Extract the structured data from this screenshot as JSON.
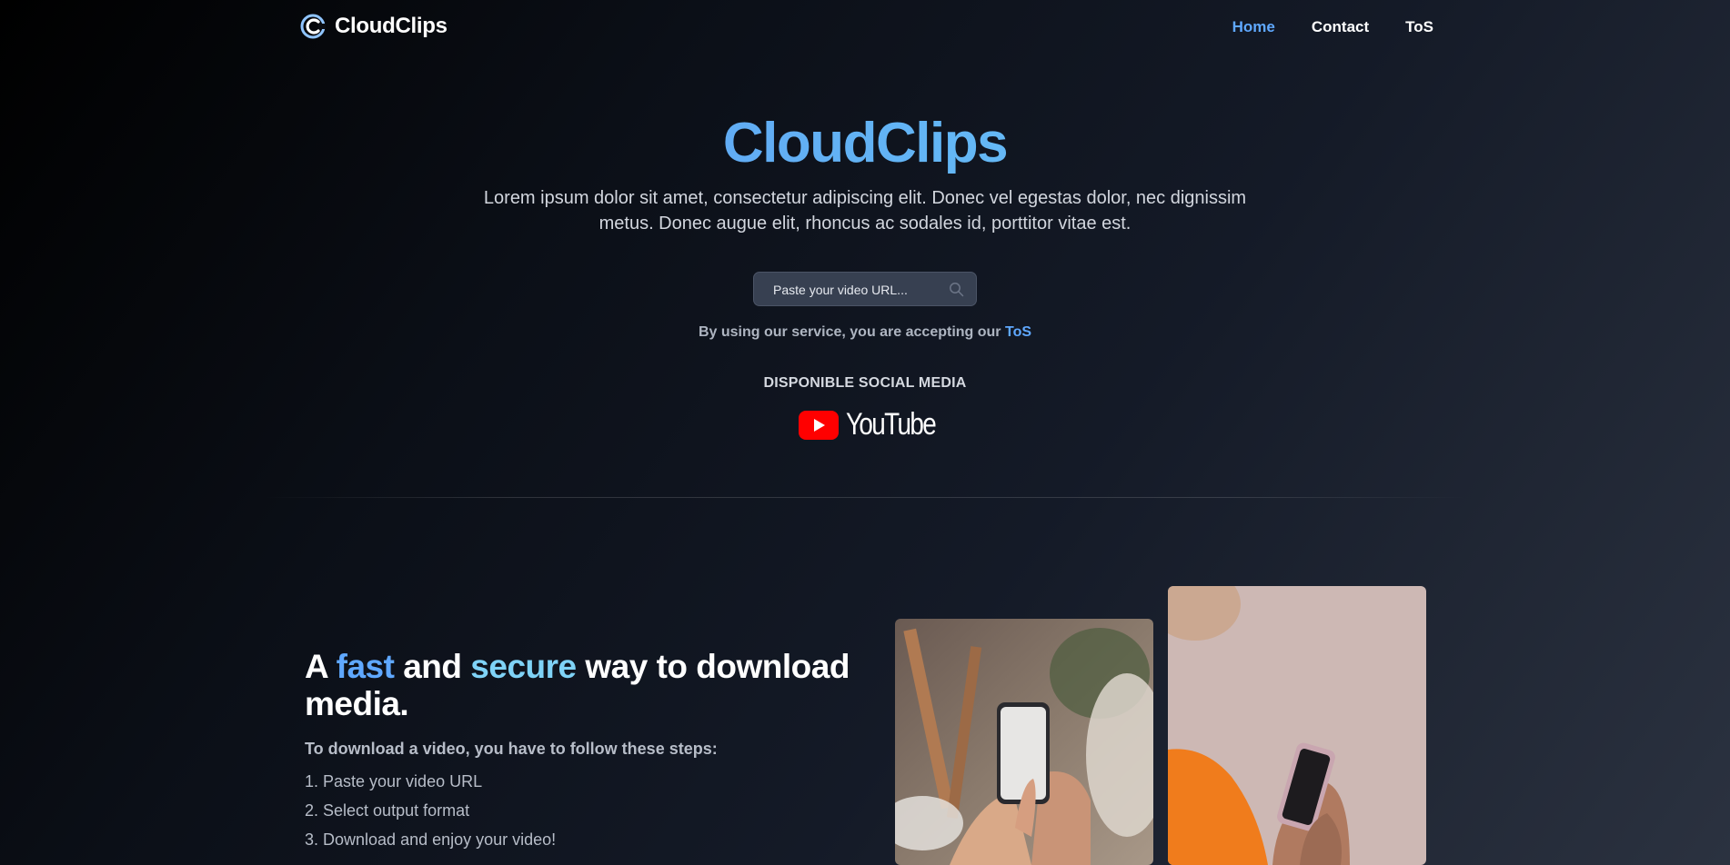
{
  "nav": {
    "brand": "CloudClips",
    "links": [
      {
        "label": "Home",
        "active": true
      },
      {
        "label": "Contact",
        "active": false
      },
      {
        "label": "ToS",
        "active": false
      }
    ]
  },
  "hero": {
    "title": "CloudClips",
    "description": "Lorem ipsum dolor sit amet, consectetur adipiscing elit. Donec vel egestas dolor, nec dignissim metus. Donec augue elit, rhoncus ac sodales id, porttitor vitae est.",
    "search": {
      "placeholder": "Paste your video URL..."
    },
    "tos_note_prefix": "By using our service, you are accepting our ",
    "tos_note_link": "ToS"
  },
  "social": {
    "heading": "DISPONIBLE SOCIAL MEDIA",
    "platforms": [
      {
        "name": "YouTube",
        "icon": "youtube-icon"
      }
    ]
  },
  "feature": {
    "title_a": "A ",
    "title_fast": "fast",
    "title_and": " and ",
    "title_secure": "secure",
    "title_rest": " way to download media.",
    "steps_intro": "To download a video, you have to follow these steps:",
    "steps": [
      "1. Paste your video URL",
      "2. Select output format",
      "3. Download and enjoy your video!"
    ]
  },
  "colors": {
    "accent": "#5fa8ff",
    "accent_light": "#7fd3f7",
    "youtube_red": "#ff0000"
  }
}
